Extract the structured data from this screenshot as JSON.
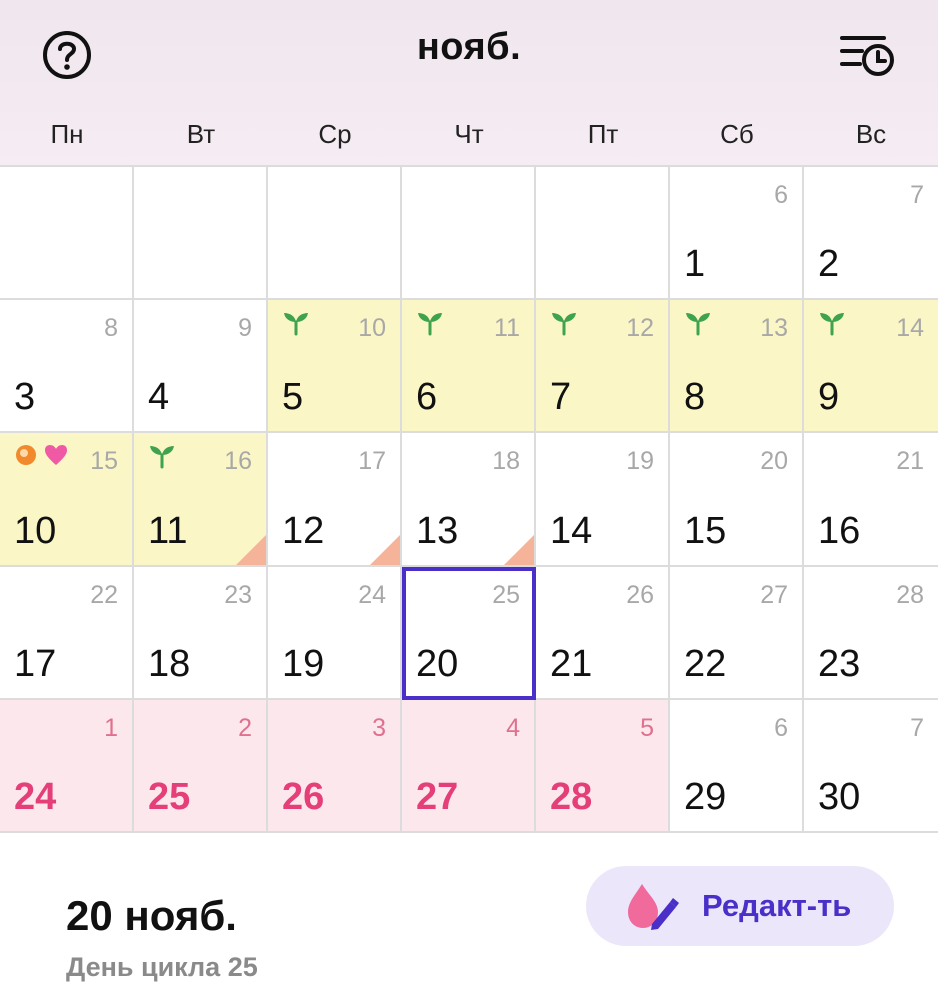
{
  "header": {
    "month": "нояб.",
    "help_icon": "help-circle-icon",
    "history_icon": "list-clock-icon"
  },
  "weekdays": [
    "Пн",
    "Вт",
    "Ср",
    "Чт",
    "Пт",
    "Сб",
    "Вс"
  ],
  "calendar": {
    "cells": [
      {
        "day": "",
        "cycle": "",
        "type": "empty"
      },
      {
        "day": "",
        "cycle": "",
        "type": "empty"
      },
      {
        "day": "",
        "cycle": "",
        "type": "empty"
      },
      {
        "day": "",
        "cycle": "",
        "type": "empty"
      },
      {
        "day": "",
        "cycle": "",
        "type": "empty"
      },
      {
        "day": "1",
        "cycle": "6",
        "type": "normal"
      },
      {
        "day": "2",
        "cycle": "7",
        "type": "normal"
      },
      {
        "day": "3",
        "cycle": "8",
        "type": "normal"
      },
      {
        "day": "4",
        "cycle": "9",
        "type": "normal"
      },
      {
        "day": "5",
        "cycle": "10",
        "type": "fertile",
        "icons": [
          "sprout-icon"
        ]
      },
      {
        "day": "6",
        "cycle": "11",
        "type": "fertile",
        "icons": [
          "sprout-icon"
        ]
      },
      {
        "day": "7",
        "cycle": "12",
        "type": "fertile",
        "icons": [
          "sprout-icon"
        ]
      },
      {
        "day": "8",
        "cycle": "13",
        "type": "fertile",
        "icons": [
          "sprout-icon"
        ]
      },
      {
        "day": "9",
        "cycle": "14",
        "type": "fertile",
        "icons": [
          "sprout-icon"
        ]
      },
      {
        "day": "10",
        "cycle": "15",
        "type": "fertile",
        "icons": [
          "ovulation-icon",
          "heart-icon"
        ]
      },
      {
        "day": "11",
        "cycle": "16",
        "type": "fertile",
        "icons": [
          "sprout-icon"
        ],
        "note": true
      },
      {
        "day": "12",
        "cycle": "17",
        "type": "normal",
        "note": true
      },
      {
        "day": "13",
        "cycle": "18",
        "type": "normal",
        "note": true
      },
      {
        "day": "14",
        "cycle": "19",
        "type": "normal"
      },
      {
        "day": "15",
        "cycle": "20",
        "type": "normal"
      },
      {
        "day": "16",
        "cycle": "21",
        "type": "normal"
      },
      {
        "day": "17",
        "cycle": "22",
        "type": "normal"
      },
      {
        "day": "18",
        "cycle": "23",
        "type": "normal"
      },
      {
        "day": "19",
        "cycle": "24",
        "type": "normal"
      },
      {
        "day": "20",
        "cycle": "25",
        "type": "normal",
        "today": true
      },
      {
        "day": "21",
        "cycle": "26",
        "type": "normal"
      },
      {
        "day": "22",
        "cycle": "27",
        "type": "normal"
      },
      {
        "day": "23",
        "cycle": "28",
        "type": "normal"
      },
      {
        "day": "24",
        "cycle": "1",
        "type": "period"
      },
      {
        "day": "25",
        "cycle": "2",
        "type": "period"
      },
      {
        "day": "26",
        "cycle": "3",
        "type": "period"
      },
      {
        "day": "27",
        "cycle": "4",
        "type": "period"
      },
      {
        "day": "28",
        "cycle": "5",
        "type": "period"
      },
      {
        "day": "29",
        "cycle": "6",
        "type": "normal"
      },
      {
        "day": "30",
        "cycle": "7",
        "type": "normal"
      }
    ]
  },
  "colors": {
    "fertile_bg": "#fbf6c6",
    "period_bg": "#fce8ec",
    "period_text": "#e43f79",
    "accent": "#4a2fc8",
    "sprout": "#3fa34d",
    "note_fold": "#f5b49a"
  },
  "footer": {
    "selected_date": "20 нояб.",
    "cycle_day_text": "День цикла 25",
    "edit_label": "Редакт-ть",
    "edit_icon": "drop-pencil-icon"
  }
}
